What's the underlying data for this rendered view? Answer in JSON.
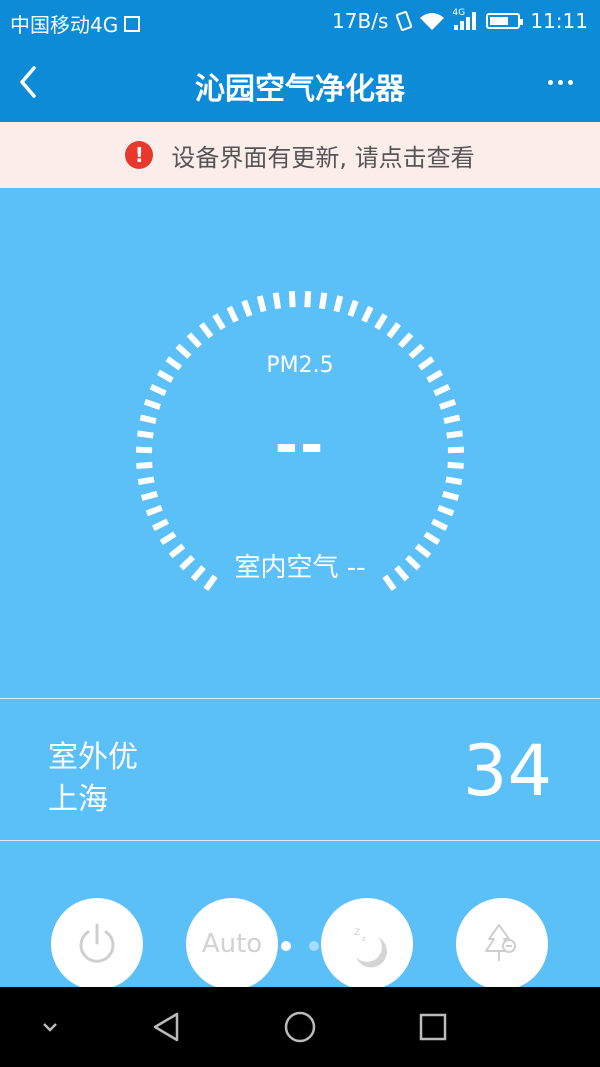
{
  "status_bar": {
    "carrier": "中国移动4G",
    "net_speed": "17B/s",
    "signal_type": "4G",
    "time": "11:11"
  },
  "header": {
    "title": "沁园空气净化器"
  },
  "notice": {
    "icon": "!",
    "text": "设备界面有更新, 请点击查看"
  },
  "gauge": {
    "label": "PM2.5",
    "value": "--",
    "indoor_text": "室内空气 --"
  },
  "outdoor": {
    "quality": "室外优",
    "city": "上海",
    "value": "34"
  },
  "controls": {
    "auto_label": "Auto",
    "page_indicator": {
      "total": 2,
      "active": 0
    }
  },
  "colors": {
    "primary": "#0d8bd6",
    "background": "#5bbff8",
    "notice_bg": "#fbeeea",
    "alert_red": "#e8392e"
  },
  "icons": [
    "back-icon",
    "more-icon",
    "alert-icon",
    "power-icon",
    "sleep-icon",
    "tree-icon",
    "nav-down-icon",
    "nav-back-icon",
    "nav-home-icon",
    "nav-recent-icon"
  ]
}
